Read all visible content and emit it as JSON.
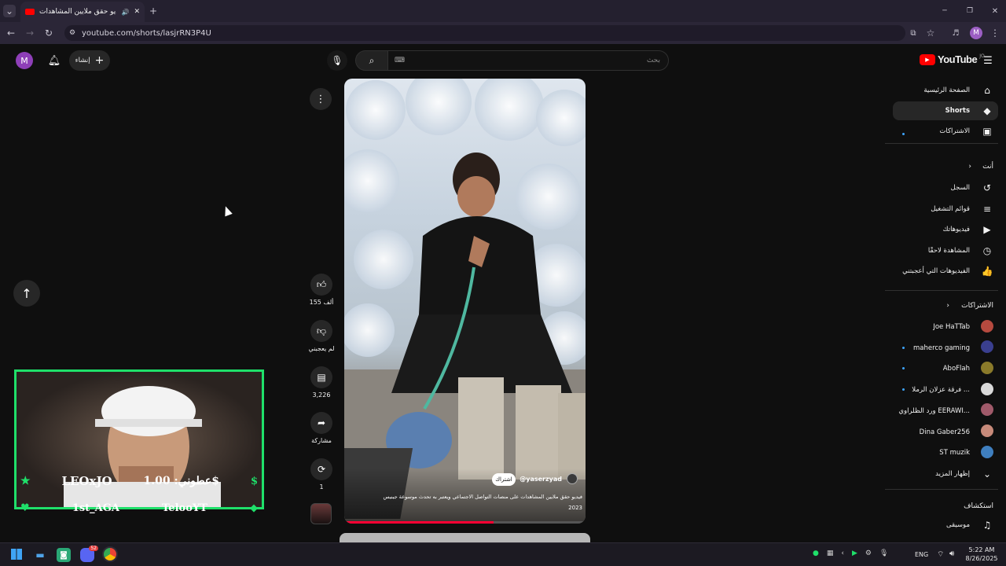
{
  "browser": {
    "tab_title": "فيديو حقق ملايين المشاهدات",
    "tab_new": "+",
    "url": "youtube.com/shorts/lasjrRN3P4U",
    "profile_letter": "M",
    "window_min": "─",
    "window_max": "❐",
    "window_close": "✕"
  },
  "header": {
    "logo_text": "YouTube",
    "logo_country": "JO",
    "search_placeholder": "بحث",
    "create_label": "إنشاء",
    "avatar_letter": "M"
  },
  "sidebar": {
    "main": [
      {
        "label": "الصفحة الرئيسية",
        "icon": "home-icon",
        "glyph": "⌂"
      },
      {
        "label": "Shorts",
        "icon": "shorts-icon",
        "glyph": "◆"
      },
      {
        "label": "الاشتراكات",
        "icon": "subscriptions-icon",
        "glyph": "▣"
      }
    ],
    "you_header": "أنت",
    "you": [
      {
        "label": "السجل",
        "icon": "history-icon",
        "glyph": "↺"
      },
      {
        "label": "قوائم التشغيل",
        "icon": "playlists-icon",
        "glyph": "≡"
      },
      {
        "label": "فيديوهاتك",
        "icon": "your-videos-icon",
        "glyph": "▶"
      },
      {
        "label": "المشاهدة لاحقًا",
        "icon": "watch-later-icon",
        "glyph": "◷"
      },
      {
        "label": "الفيديوهات التي أعجبتني",
        "icon": "liked-icon",
        "glyph": "👍"
      }
    ],
    "subs_header": "الاشتراكات",
    "subscriptions": [
      {
        "label": "Joe HaTTab",
        "color": "#b64a3f",
        "dot": false
      },
      {
        "label": "maherco gaming",
        "color": "#3a3f8f",
        "dot": true
      },
      {
        "label": "AboFlah",
        "color": "#8a7a2a",
        "dot": true
      },
      {
        "label": "فرقة عزلان الرملا ...",
        "color": "#d9d9d9",
        "dot": true
      },
      {
        "label": "ورد الظلراوي EERAWI...",
        "color": "#a05a6a",
        "dot": false
      },
      {
        "label": "Dina Gaber256",
        "color": "#c78a7a",
        "dot": false
      },
      {
        "label": "ST muzik",
        "color": "#3f7fbf",
        "dot": false
      }
    ],
    "show_more": "إظهار المزيد",
    "explore_header": "استكشاف",
    "explore": [
      {
        "label": "موسيقى",
        "icon": "music-icon",
        "glyph": "♫"
      }
    ]
  },
  "actions": {
    "likes": "155 ألف",
    "dislike": "لم يعجبني",
    "comments": "3,226",
    "share": "مشاركة",
    "remix": "1"
  },
  "video": {
    "channel": "@yaserzyad",
    "subscribe": "اشتراك",
    "caption": "فيديو حقق ملايين المشاهدات على منصات التواصل الاجتماعي ويعتبر به تحدث موسوعة جينيس",
    "date": "2023"
  },
  "cam": {
    "name1": "LEOxJO",
    "donate": "عطوني: 1.00$",
    "name2": "1st_AGA",
    "name3": "TelooYT"
  },
  "taskbar": {
    "lang": "ENG",
    "time": "5:22 AM",
    "date": "8/26/2025",
    "discord_badge": "52"
  }
}
